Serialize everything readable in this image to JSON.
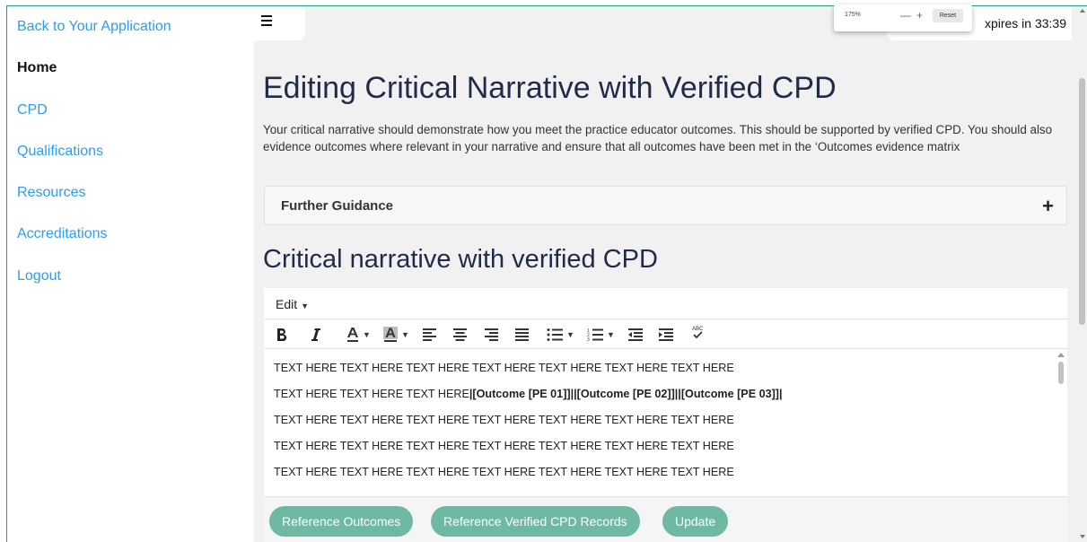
{
  "sidebar": {
    "items": [
      {
        "label": "Back to Your Application"
      },
      {
        "label": "Home"
      },
      {
        "label": "CPD"
      },
      {
        "label": "Qualifications"
      },
      {
        "label": "Resources"
      },
      {
        "label": "Accreditations"
      },
      {
        "label": "Logout"
      }
    ],
    "link_color": "#2a9df4"
  },
  "header": {
    "session_text": "xpires in 33:39"
  },
  "zoom": {
    "percent": "175%",
    "minus": "—",
    "plus": "+",
    "reset": "Reset"
  },
  "page": {
    "title": "Editing Critical Narrative with Verified CPD",
    "intro": "Your critical narrative should demonstrate how you meet the practice educator outcomes. This should be supported by verified CPD. You should also evidence outcomes where relevant in your narrative and ensure that all outcomes have been met in the ‘Outcomes evidence matrix",
    "guidance_label": "Further Guidance",
    "guidance_icon": "+",
    "section_title": "Critical narrative with verified CPD"
  },
  "editor": {
    "menu_edit": "Edit",
    "toolbar": [
      "bold-icon",
      "italic-icon",
      "text-color-icon",
      "background-color-icon",
      "align-left-icon",
      "align-center-icon",
      "align-right-icon",
      "align-justify-icon",
      "bullet-list-icon",
      "numbered-list-icon",
      "outdent-icon",
      "indent-icon",
      "spellcheck-icon"
    ],
    "lines": [
      {
        "text": "TEXT HERE TEXT HERE TEXT HERE TEXT HERE TEXT HERE TEXT HERE TEXT HERE"
      },
      {
        "text": "TEXT HERE TEXT HERE TEXT HERE",
        "bold": "|[Outcome [PE 01]]||[Outcome [PE 02]]||[Outcome [PE 03]]|"
      },
      {
        "text": "TEXT HERE TEXT HERE TEXT HERE TEXT HERE TEXT HERE TEXT HERE TEXT HERE"
      },
      {
        "text": "TEXT HERE TEXT HERE TEXT HERE TEXT HERE TEXT HERE TEXT HERE TEXT HERE"
      },
      {
        "text": "TEXT HERE TEXT HERE TEXT HERE TEXT HERE TEXT HERE TEXT HERE TEXT HERE"
      }
    ],
    "buttons": [
      {
        "label": "Reference Outcomes"
      },
      {
        "label": "Reference Verified CPD Records"
      },
      {
        "label": "Update"
      }
    ],
    "button_color": "#6fb8a4"
  },
  "colors": {
    "accent_border": "#1f9e87",
    "title": "#1f2b4a",
    "main_bg": "#f1f1f1"
  }
}
